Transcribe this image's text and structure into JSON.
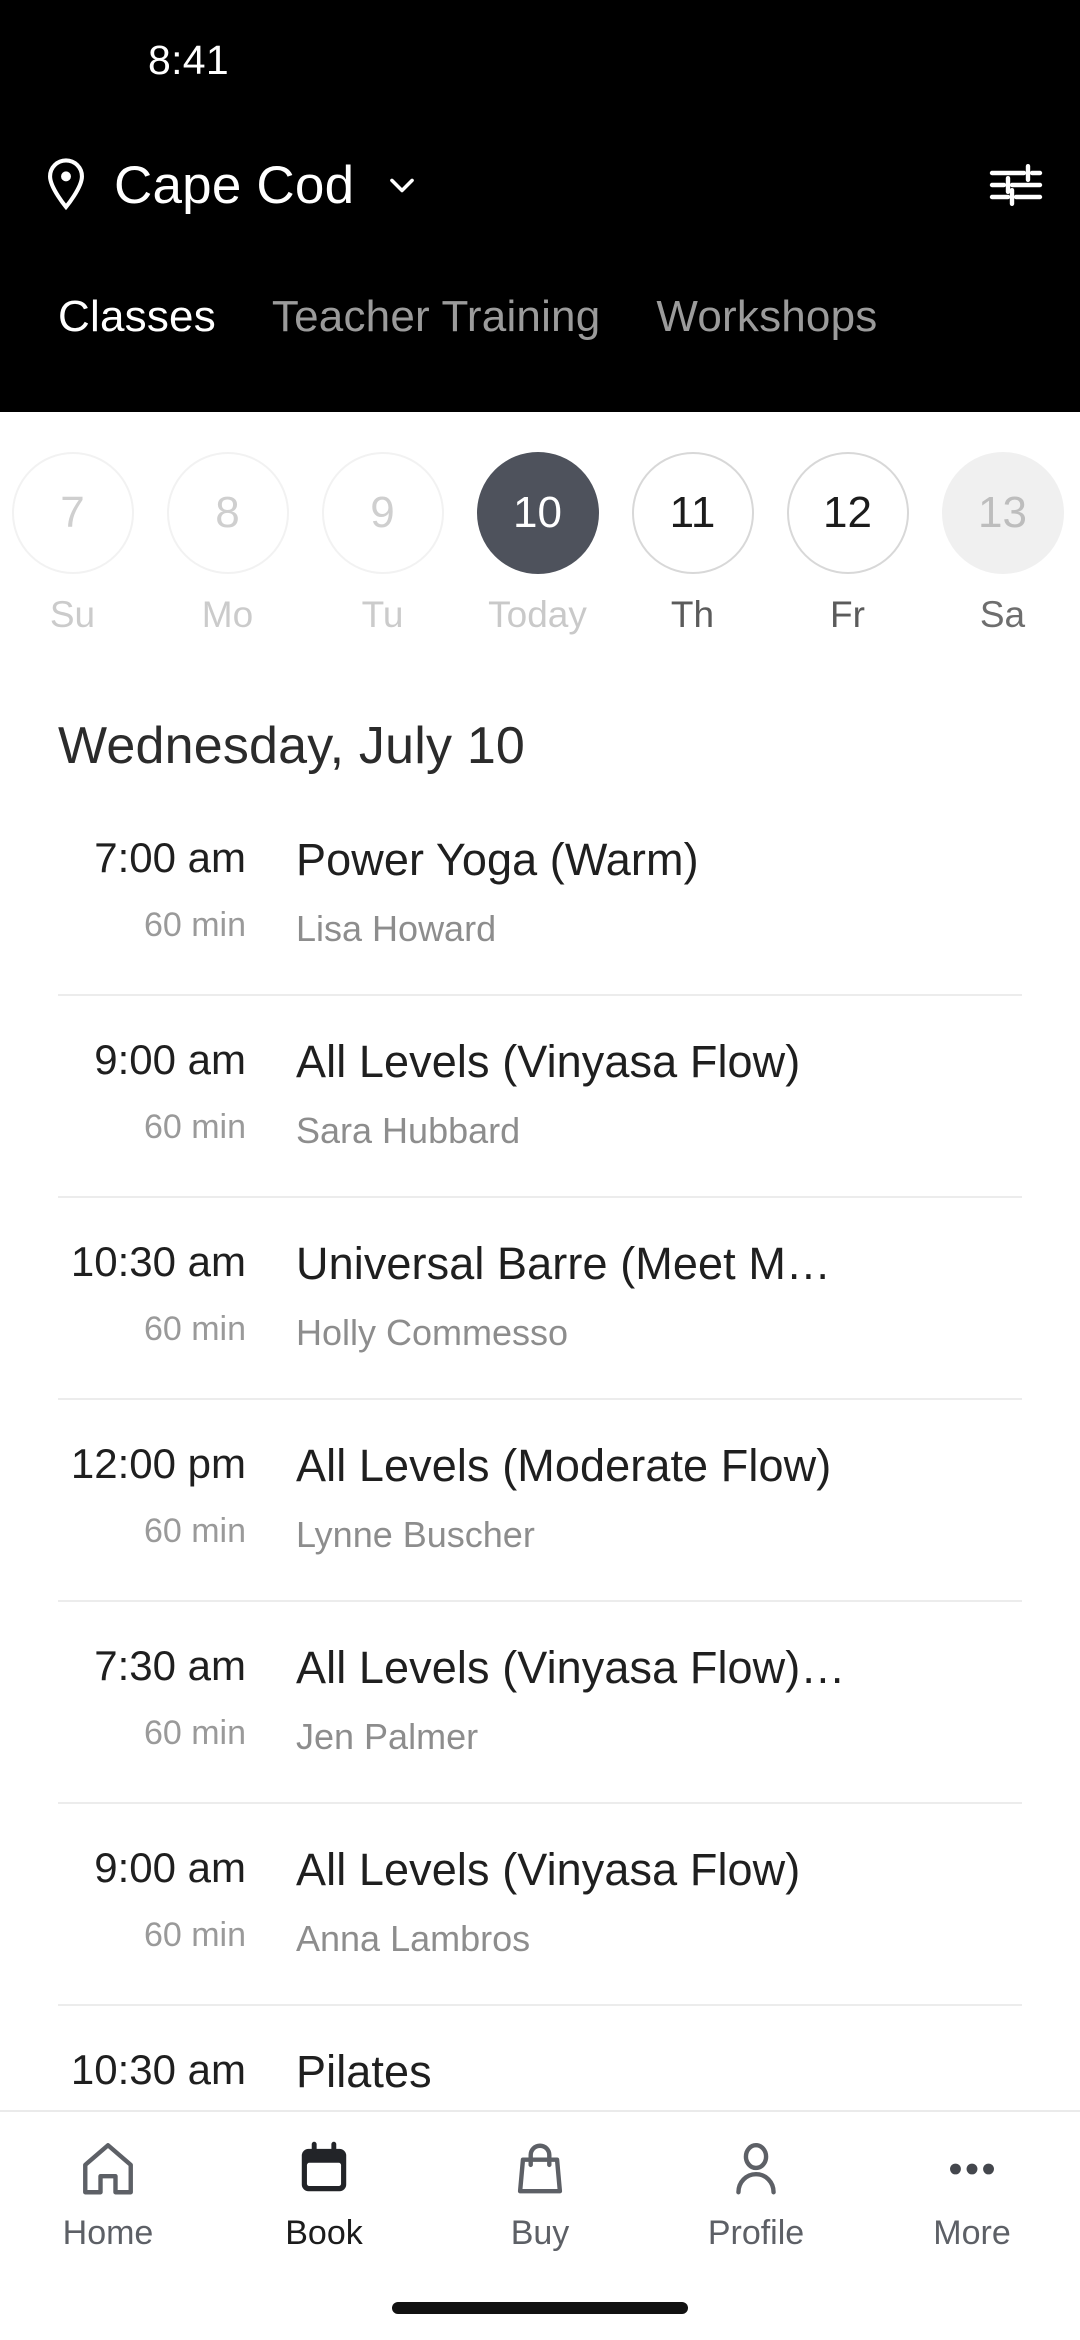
{
  "status_bar": {
    "time": "8:41"
  },
  "header": {
    "location_name": "Cape Cod",
    "location_pin_icon": "location-pin-icon",
    "chevron_icon": "chevron-down-icon",
    "filter_icon": "tune-filter-icon",
    "background_color": "#000000",
    "tabs": [
      {
        "label": "Classes",
        "active": true
      },
      {
        "label": "Teacher Training",
        "active": false
      },
      {
        "label": "Workshops",
        "active": false
      }
    ]
  },
  "date_strip": {
    "selected_accent_color": "#4e525c",
    "days": [
      {
        "num": "7",
        "label": "Su",
        "state": "past"
      },
      {
        "num": "8",
        "label": "Mo",
        "state": "past"
      },
      {
        "num": "9",
        "label": "Tu",
        "state": "past"
      },
      {
        "num": "10",
        "label": "Today",
        "state": "selected"
      },
      {
        "num": "11",
        "label": "Th",
        "state": "future"
      },
      {
        "num": "12",
        "label": "Fr",
        "state": "future"
      },
      {
        "num": "13",
        "label": "Sa",
        "state": "edge"
      }
    ]
  },
  "day_title": "Wednesday, July 10",
  "classes": [
    {
      "time": "7:00 am",
      "duration": "60 min",
      "name": "Power Yoga (Warm)",
      "teacher": "Lisa Howard"
    },
    {
      "time": "9:00 am",
      "duration": "60 min",
      "name": "All Levels (Vinyasa Flow)",
      "teacher": "Sara Hubbard"
    },
    {
      "time": "10:30 am",
      "duration": "60 min",
      "name": "Universal Barre (Meet M…",
      "teacher": "Holly Commesso"
    },
    {
      "time": "12:00 pm",
      "duration": "60 min",
      "name": "All Levels (Moderate Flow)",
      "teacher": "Lynne Buscher"
    },
    {
      "time": "7:30 am",
      "duration": "60 min",
      "name": "All Levels (Vinyasa Flow)…",
      "teacher": "Jen Palmer"
    },
    {
      "time": "9:00 am",
      "duration": "60 min",
      "name": "All Levels (Vinyasa Flow)",
      "teacher": "Anna Lambros"
    },
    {
      "time": "10:30 am",
      "duration": "",
      "name": "Pilates",
      "teacher": ""
    }
  ],
  "bottom_nav": {
    "items": [
      {
        "label": "Home",
        "icon": "home-icon",
        "active": false
      },
      {
        "label": "Book",
        "icon": "calendar-icon",
        "active": true
      },
      {
        "label": "Buy",
        "icon": "shopping-bag-icon",
        "active": false
      },
      {
        "label": "Profile",
        "icon": "person-icon",
        "active": false
      },
      {
        "label": "More",
        "icon": "more-dots-icon",
        "active": false
      }
    ]
  }
}
